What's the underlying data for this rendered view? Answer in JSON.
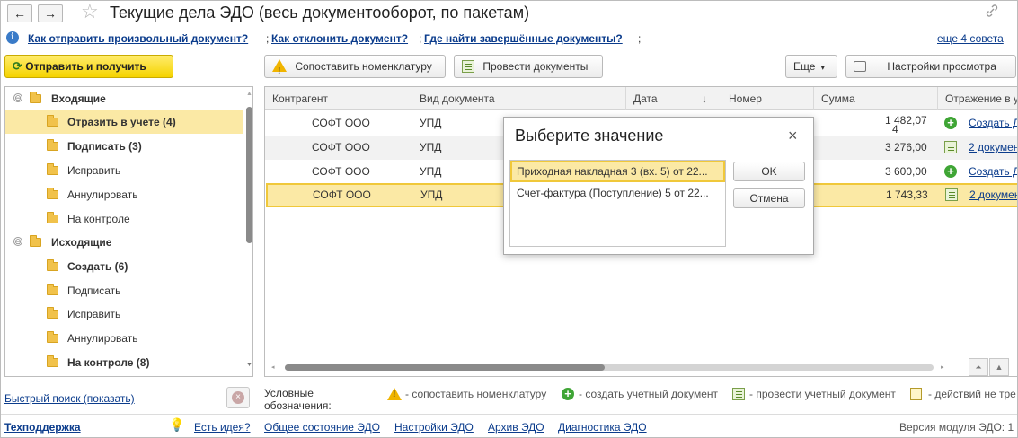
{
  "window": {
    "title": "Текущие дела ЭДО (весь документооборот, по пакетам)",
    "back_glyph": "←",
    "forward_glyph": "→",
    "favorite_glyph": "☆",
    "link_glyph": "🔗"
  },
  "tips": {
    "info_glyph": "i",
    "links": [
      "Как отправить произвольный документ?",
      "Как отклонить документ?",
      "Где найти завершённые документы?"
    ],
    "separator": ";",
    "more": "еще 4 совета"
  },
  "toolbar": {
    "send_receive": "Отправить и получить",
    "match_nomenclature": "Сопоставить номенклатуру",
    "post_documents": "Провести документы",
    "more": "Еще",
    "view_settings": "Настройки просмотра"
  },
  "tree": {
    "groups": [
      {
        "label": "Входящие",
        "collapse_glyph": "⊖"
      },
      {
        "label": "Исходящие",
        "collapse_glyph": "⊖"
      }
    ],
    "items": [
      {
        "label": "Отразить в учете (4)",
        "bold": true
      },
      {
        "label": "Подписать (3)",
        "bold": true
      },
      {
        "label": "Исправить",
        "bold": false
      },
      {
        "label": "Аннулировать",
        "bold": false
      },
      {
        "label": "На контроле",
        "bold": false
      },
      {
        "label": "Создать (6)",
        "bold": true
      },
      {
        "label": "Подписать",
        "bold": false
      },
      {
        "label": "Исправить",
        "bold": false
      },
      {
        "label": "Аннулировать",
        "bold": false
      },
      {
        "label": "На контроле (8)",
        "bold": true
      }
    ]
  },
  "grid": {
    "columns": [
      "Контрагент",
      "Вид документа",
      "Дата",
      "Номер",
      "Сумма",
      "Отражение в у"
    ],
    "sort_glyph": "↓",
    "rows": [
      {
        "counterparty": "СОФТ ООО",
        "doc_type": "УПД",
        "sum": "1 482,07",
        "sum_extra": "4",
        "action": "Создать Д",
        "icon": "plus-icon"
      },
      {
        "counterparty": "СОФТ ООО",
        "doc_type": "УПД",
        "sum": "3 276,00",
        "sum_extra": "",
        "action": "2 докумен",
        "icon": "document-icon"
      },
      {
        "counterparty": "СОФТ ООО",
        "doc_type": "УПД",
        "sum": "3 600,00",
        "sum_extra": "",
        "action": "Создать Д",
        "icon": "plus-icon"
      },
      {
        "counterparty": "СОФТ ООО",
        "doc_type": "УПД",
        "sum": "1 743,33",
        "sum_extra": "",
        "action": "2 докумен",
        "icon": "document-icon"
      }
    ]
  },
  "dialog": {
    "title": "Выберите значение",
    "close_glyph": "×",
    "items": [
      "Приходная накладная 3 (вх. 5) от 22...",
      "Счет-фактура (Поступление) 5 от 22..."
    ],
    "ok": "OK",
    "cancel": "Отмена"
  },
  "legend": {
    "label_line1": "Условные",
    "label_line2": "обозначения:",
    "entries": [
      "- сопоставить номенклатуру",
      "- создать учетный документ",
      "- провести учетный документ",
      "- действий не тре"
    ]
  },
  "quick_search": "Быстрый поиск (показать)",
  "footer": {
    "support": "Техподдержка",
    "idea": "Есть идея?",
    "links": [
      "Общее состояние ЭДО",
      "Настройки ЭДО",
      "Архив ЭДО",
      "Диагностика ЭДО"
    ],
    "version": "Версия модуля ЭДО: 1"
  },
  "colors": {
    "accent_yellow": "#f5d300",
    "selection": "#fbe9a5",
    "link": "#0b3c8c",
    "plus_green": "#3fa535"
  }
}
